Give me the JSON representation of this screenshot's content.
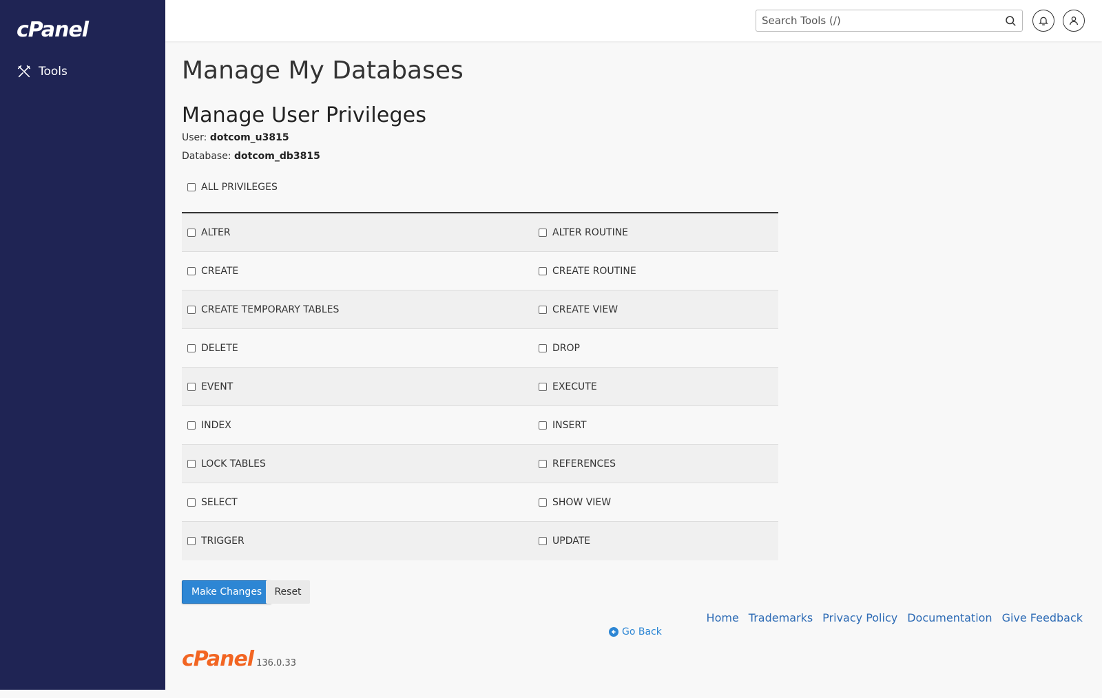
{
  "sidebar": {
    "logo_text": "cPanel",
    "nav": [
      {
        "label": "Tools",
        "icon": "tools-icon"
      }
    ],
    "bg_color": "#1f2454"
  },
  "topbar": {
    "search_placeholder": "Search Tools (/)"
  },
  "main": {
    "page_title": "Manage My Databases",
    "section_title": "Manage User Privileges",
    "user_label": "User:",
    "user_value": "dotcom_u3815",
    "database_label": "Database:",
    "database_value": "dotcom_db3815",
    "all_privileges_label": "ALL PRIVILEGES",
    "privileges": [
      [
        "ALTER",
        "ALTER ROUTINE"
      ],
      [
        "CREATE",
        "CREATE ROUTINE"
      ],
      [
        "CREATE TEMPORARY TABLES",
        "CREATE VIEW"
      ],
      [
        "DELETE",
        "DROP"
      ],
      [
        "EVENT",
        "EXECUTE"
      ],
      [
        "INDEX",
        "INSERT"
      ],
      [
        "LOCK TABLES",
        "REFERENCES"
      ],
      [
        "SELECT",
        "SHOW VIEW"
      ],
      [
        "TRIGGER",
        "UPDATE"
      ]
    ],
    "make_changes_label": "Make Changes",
    "reset_label": "Reset",
    "go_back_label": "Go Back"
  },
  "footer": {
    "brand": "cPanel",
    "version": "136.0.33",
    "links": [
      "Home",
      "Trademarks",
      "Privacy Policy",
      "Documentation",
      "Give Feedback"
    ]
  },
  "colors": {
    "primary": "#2d86d4",
    "brand_orange": "#f26522",
    "link": "#2d6bb5"
  }
}
